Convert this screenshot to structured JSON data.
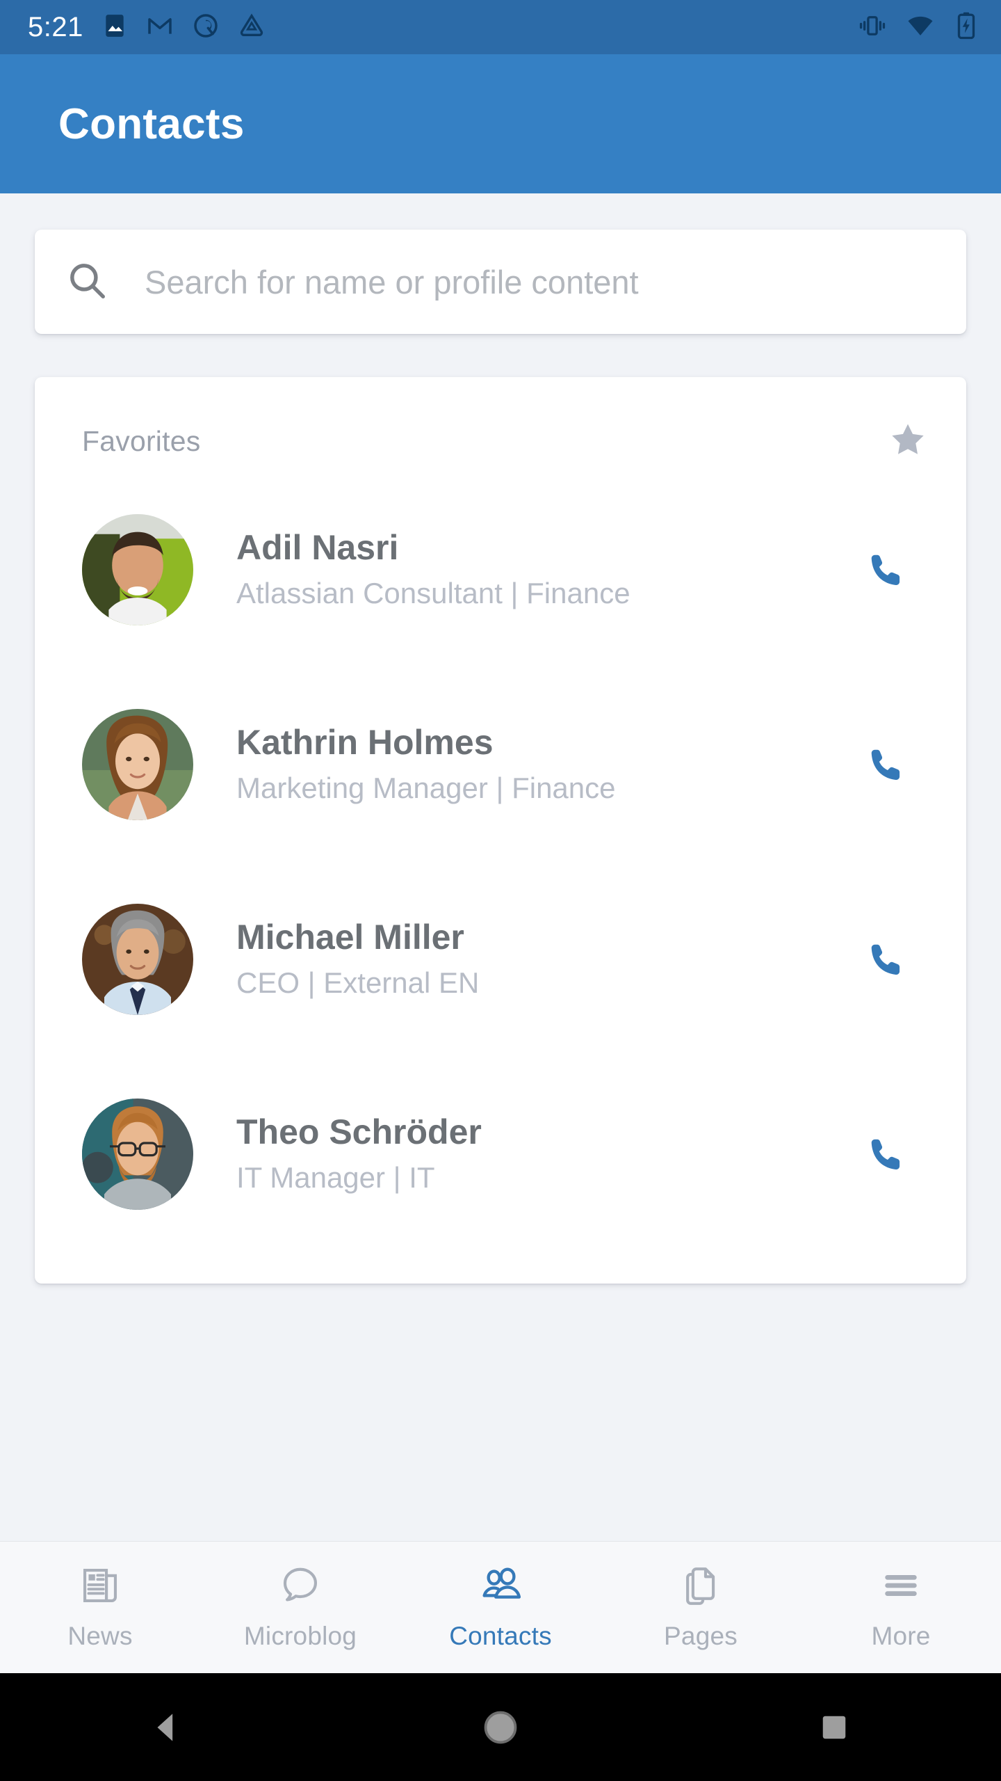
{
  "status_bar": {
    "time": "5:21",
    "left_icons": [
      "image-icon",
      "gmail-icon",
      "circle-q-icon",
      "drive-triangle-icon"
    ],
    "right_icons": [
      "vibrate-icon",
      "wifi-icon",
      "battery-charging-icon"
    ],
    "background_color": "#2c6ba8"
  },
  "app_bar": {
    "title": "Contacts",
    "background_color": "#3580c4",
    "title_color": "#ffffff"
  },
  "search": {
    "placeholder": "Search for name or profile content",
    "value": "",
    "icon": "search-icon"
  },
  "favorites": {
    "title": "Favorites",
    "star_icon": "star-filled-icon",
    "star_color": "#b2b8c4",
    "contacts": [
      {
        "name": "Adil Nasri",
        "subtitle": "Atlassian Consultant | Finance",
        "action_icon": "phone-icon",
        "avatar": "photo-man-beard-green-chair"
      },
      {
        "name": "Kathrin Holmes",
        "subtitle": "Marketing Manager | Finance",
        "action_icon": "phone-icon",
        "avatar": "photo-woman-long-hair-outdoors"
      },
      {
        "name": "Michael Miller",
        "subtitle": "CEO | External EN",
        "action_icon": "phone-icon",
        "avatar": "photo-man-shirt-tie"
      },
      {
        "name": "Theo Schröder",
        "subtitle": "IT Manager | IT",
        "action_icon": "phone-icon",
        "avatar": "photo-man-glasses-beard"
      }
    ]
  },
  "bottom_nav": {
    "active": "Contacts",
    "accent_color": "#3579b8",
    "inactive_color": "#aab0ba",
    "items": [
      {
        "label": "News",
        "icon": "newspaper-icon"
      },
      {
        "label": "Microblog",
        "icon": "speech-bubble-icon"
      },
      {
        "label": "Contacts",
        "icon": "people-icon"
      },
      {
        "label": "Pages",
        "icon": "documents-icon"
      },
      {
        "label": "More",
        "icon": "hamburger-icon"
      }
    ]
  },
  "system_nav": {
    "buttons": [
      "back-icon",
      "home-icon",
      "recents-icon"
    ],
    "icon_color": "#9e9e9e"
  },
  "theme": {
    "page_background": "#f1f3f7",
    "card_background": "#ffffff",
    "phone_icon_color": "#3579b8",
    "name_color": "#6b7075",
    "subtitle_color": "#b7bcc6"
  }
}
